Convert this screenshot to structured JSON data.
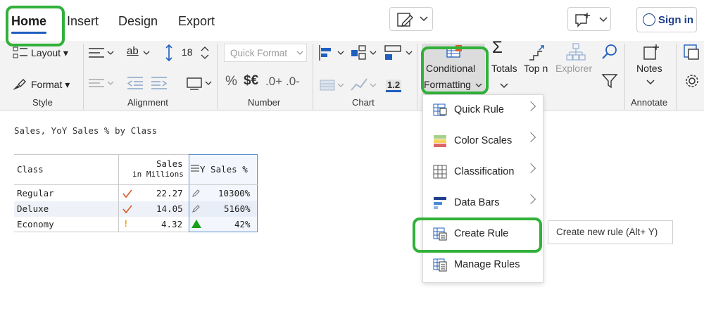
{
  "tabs": [
    {
      "label": "Home",
      "active": true
    },
    {
      "label": "Insert"
    },
    {
      "label": "Design"
    },
    {
      "label": "Export"
    }
  ],
  "topbar": {
    "signin_label": "Sign in"
  },
  "ribbon": {
    "style": {
      "layout_label": "Layout",
      "format_label": "Format",
      "group_label": "Style"
    },
    "alignment": {
      "font_size": "18",
      "group_label": "Alignment"
    },
    "number": {
      "quick_format_placeholder": "Quick Format",
      "percent": "%",
      "currency": "$€",
      "inc_decimal": ".0+",
      "dec_decimal": ".0-",
      "group_label": "Number"
    },
    "chart": {
      "value_badge": "1.2",
      "group_label": "Chart"
    },
    "conditional_formatting": {
      "line1": "Conditional",
      "line2": "Formatting"
    },
    "totals_label": "Totals",
    "topn_label": "Top n",
    "explorer_label": "Explorer",
    "notes_label": "Notes",
    "annotate_group_label": "Annotate"
  },
  "report": {
    "title": "Sales, YoY Sales % by Class",
    "columns": {
      "class": "Class",
      "sales": "Sales",
      "sales_sub": "in Millions",
      "yoy": "YoY Sales %",
      "yoy_visible": "Y Sales %"
    },
    "rows": [
      {
        "class": "Regular",
        "sales": "22.27",
        "yoy": "10300%"
      },
      {
        "class": "Deluxe",
        "sales": "14.05",
        "yoy": "5160%"
      },
      {
        "class": "Economy",
        "sales": "4.32",
        "yoy": "42%"
      }
    ]
  },
  "menu": {
    "items": [
      {
        "label": "Quick Rule",
        "submenu": true
      },
      {
        "label": "Color Scales",
        "submenu": true
      },
      {
        "label": "Classification",
        "submenu": true
      },
      {
        "label": "Data Bars",
        "submenu": true
      },
      {
        "label": "Create Rule",
        "submenu": false
      },
      {
        "label": "Manage Rules",
        "submenu": false
      }
    ]
  },
  "tooltip": "Create new rule (Alt+ Y)",
  "colors": {
    "highlight": "#31b13a",
    "accent": "#1f5fbf",
    "check": "#e05a2a",
    "warn": "#f0a000",
    "up": "#1aa01a"
  }
}
